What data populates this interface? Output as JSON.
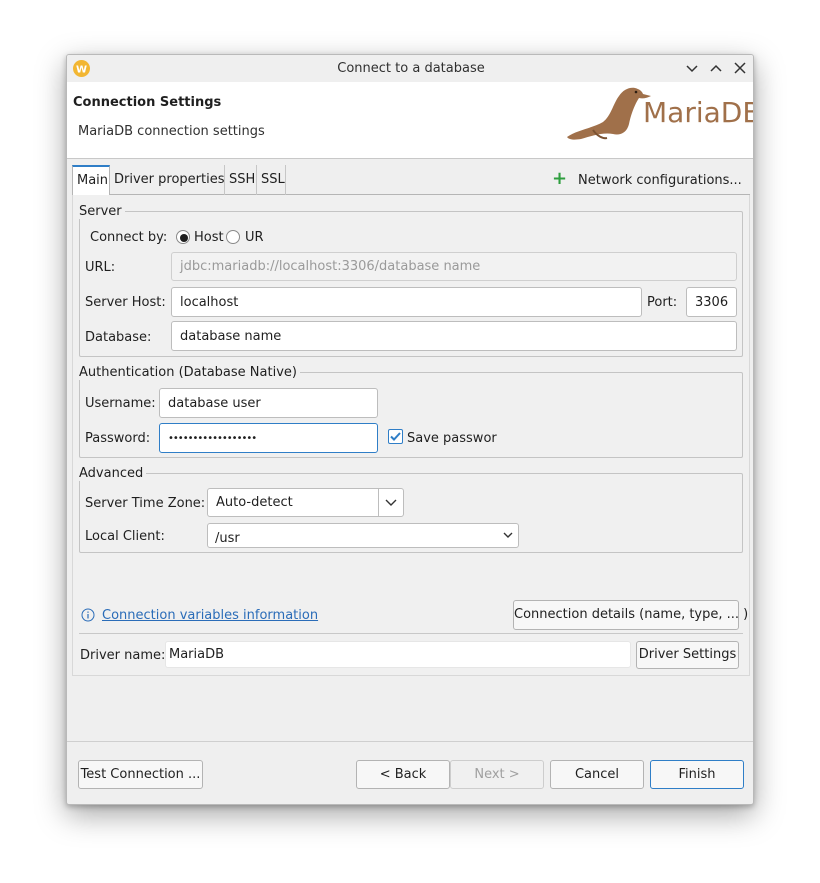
{
  "window": {
    "title": "Connect to a database"
  },
  "header": {
    "title": "Connection Settings",
    "subtitle": "MariaDB connection settings",
    "logo_text": "MariaDB"
  },
  "tabs": [
    {
      "label": "Main",
      "active": true
    },
    {
      "label": "Driver properties",
      "active": false
    },
    {
      "label": "SSH",
      "active": false
    },
    {
      "label": "SSL",
      "active": false
    }
  ],
  "network_configurations": "Network configurations...",
  "server": {
    "legend": "Server",
    "connect_by_label": "Connect by:",
    "connect_by_options": [
      {
        "label": "Host",
        "checked": true
      },
      {
        "label": "UR",
        "checked": false
      }
    ],
    "url_label": "URL:",
    "url_value": "jdbc:mariadb://localhost:3306/database name",
    "host_label": "Server Host:",
    "host_value": "localhost",
    "port_label": "Port:",
    "port_value": "3306",
    "database_label": "Database:",
    "database_value": "database name"
  },
  "auth": {
    "legend": "Authentication (Database Native)",
    "username_label": "Username:",
    "username_value": "database user",
    "password_label": "Password:",
    "password_value": "••••••••••••••••••",
    "save_password_label": "Save passwor",
    "save_password_checked": true
  },
  "advanced": {
    "legend": "Advanced",
    "timezone_label": "Server Time Zone:",
    "timezone_value": "Auto-detect",
    "local_client_label": "Local Client:",
    "local_client_value": "/usr"
  },
  "info_link": "Connection variables information",
  "connection_details_button": "Connection details (name, type, ... )",
  "driver": {
    "label": "Driver name:",
    "value": "MariaDB",
    "settings_button": "Driver Settings"
  },
  "footer": {
    "test_connection": "Test Connection ...",
    "back": "< Back",
    "next": "Next >",
    "cancel": "Cancel",
    "finish": "Finish"
  },
  "colors": {
    "accent": "#2f7ec7",
    "logo_brown": "#a0704a",
    "plus_green": "#2e9e3e",
    "link": "#2a6cb8"
  }
}
